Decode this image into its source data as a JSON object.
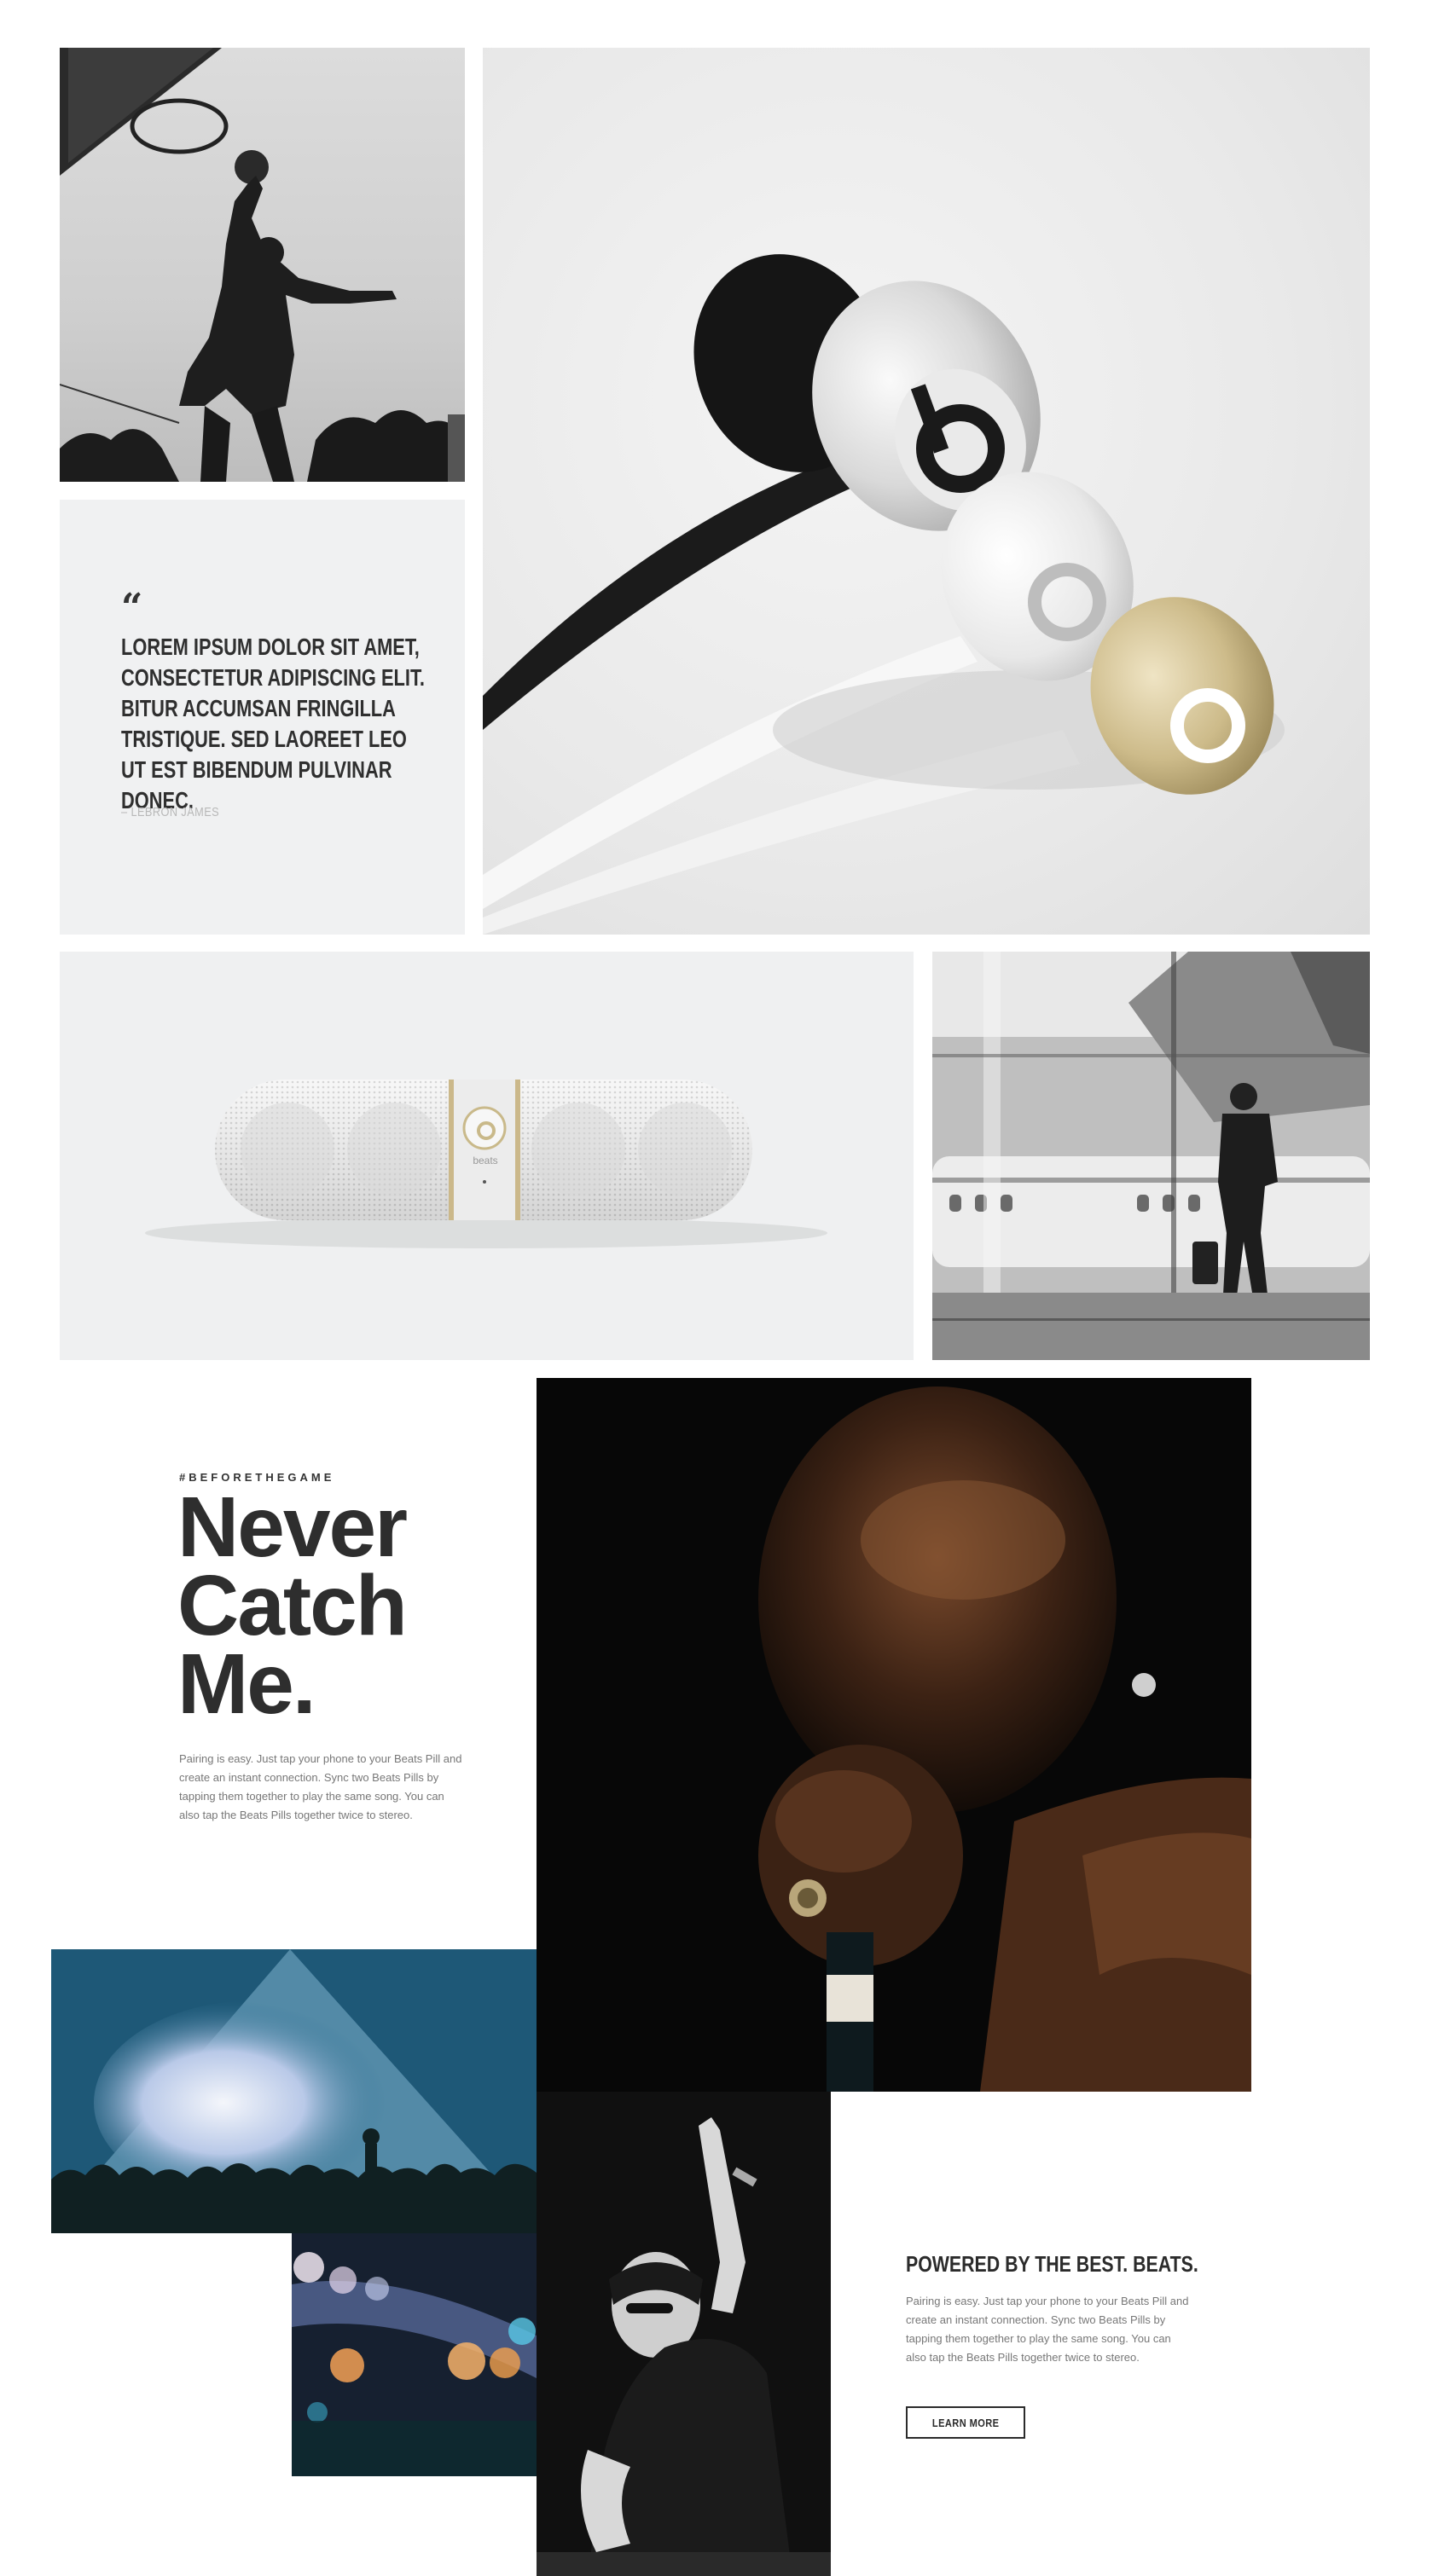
{
  "quote": {
    "mark": "“",
    "text": "LOREM IPSUM DOLOR SIT AMET, CONSECTETUR ADIPISCING ELIT. BITUR ACCUMSAN FRINGILLA TRISTIQUE. SED LAOREET LEO UT EST BIBENDUM PULVINAR DONEC.",
    "author": "– LEBRON JAMES"
  },
  "speaker": {
    "brand_label": "beats"
  },
  "hero": {
    "hashtag": "#BEFORETHEGAME",
    "headline_lines": [
      "Never",
      "Catch",
      "Me."
    ],
    "body": "Pairing is easy. Just tap your phone to your Beats Pill and create an instant connection. Sync two Beats Pills by tapping them together to play the same song. You can also tap the Beats Pills together twice to stereo."
  },
  "powered": {
    "title": "POWERED BY THE BEST. BEATS.",
    "body": "Pairing is easy. Just tap your phone to your Beats Pill and create an instant connection. Sync two Beats Pills by tapping them together to play the same song. You can also tap the Beats Pills together twice to stereo.",
    "button_label": "LEARN MORE"
  },
  "colors": {
    "text_dark": "#2e2e2e",
    "text_muted": "#777777",
    "card_bg": "#f0f1f2",
    "gold": "#c9b98a"
  }
}
